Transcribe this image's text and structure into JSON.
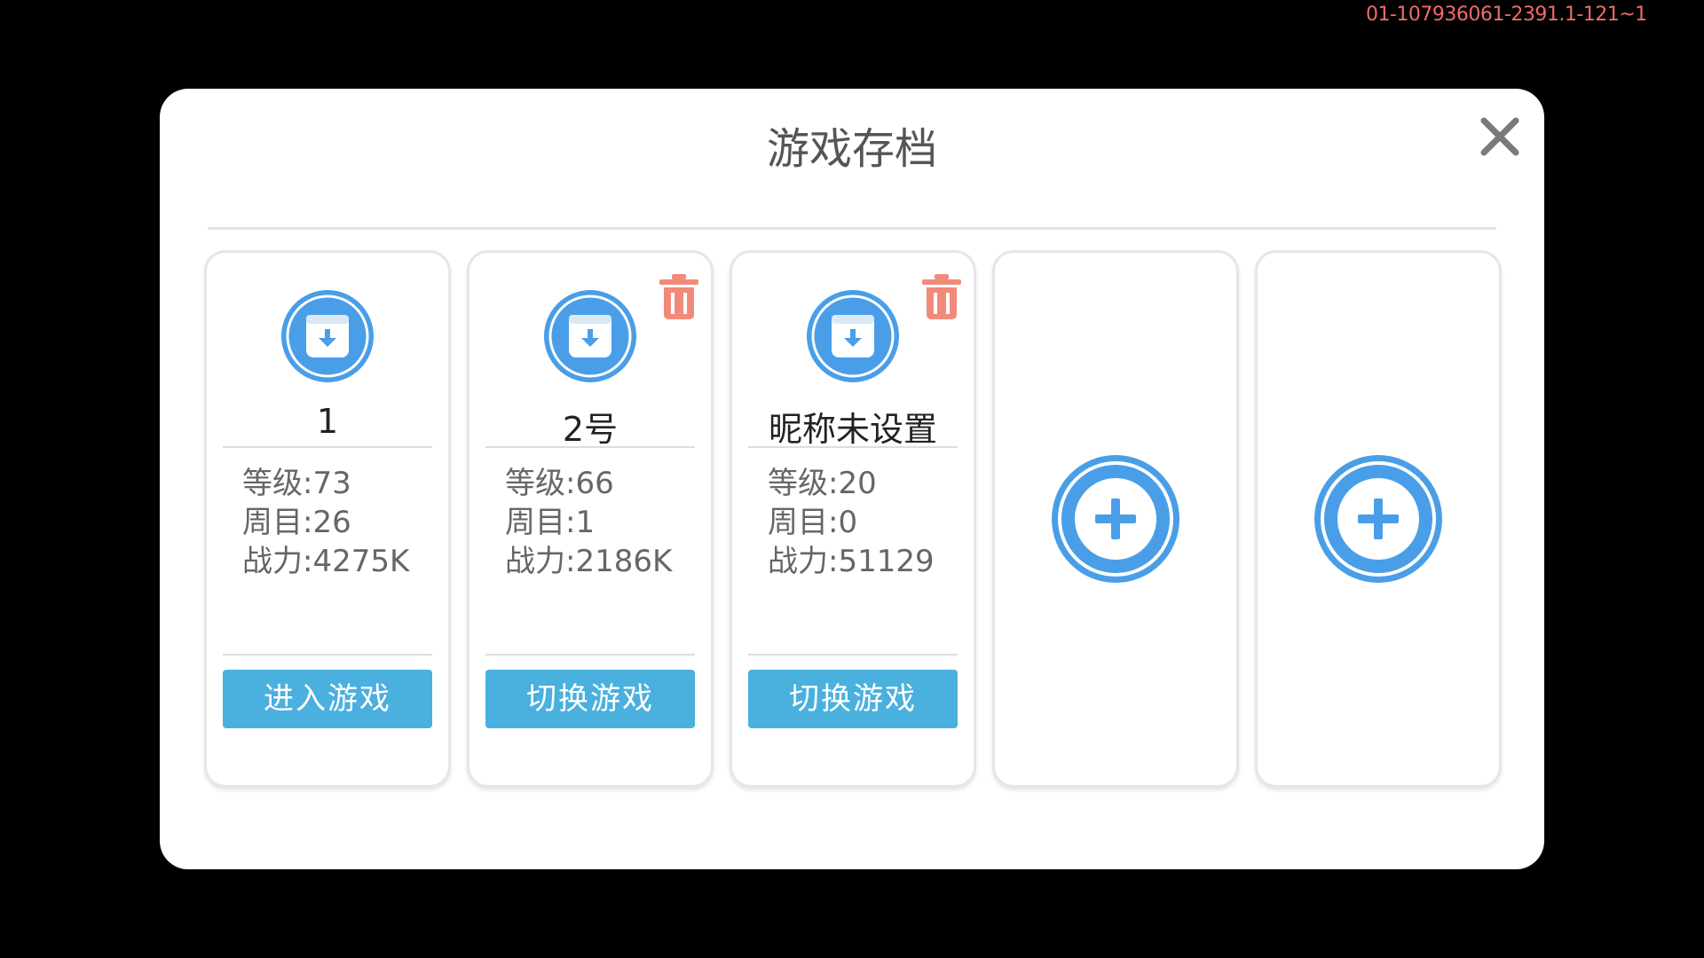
{
  "build_id": "01-107936061-2391.1-121~1",
  "dialog": {
    "title": "游戏存档",
    "close_icon": "close-icon"
  },
  "colors": {
    "accent_blue": "#4a9ee8",
    "button_blue": "#4ab0de",
    "delete_red": "#f28a7a",
    "build_id_red": "#f06a6a"
  },
  "slots": [
    {
      "name": "1",
      "stats": [
        "等级:73",
        "周目:26",
        "战力:4275K"
      ],
      "button_label": "进入游戏",
      "deletable": false,
      "icon": "save-download-icon"
    },
    {
      "name": "2号",
      "stats": [
        "等级:66",
        "周目:1",
        "战力:2186K"
      ],
      "button_label": "切换游戏",
      "deletable": true,
      "icon": "save-download-icon"
    },
    {
      "name": "昵称未设置",
      "stats": [
        "等级:20",
        "周目:0",
        "战力:51129"
      ],
      "button_label": "切换游戏",
      "deletable": true,
      "icon": "save-download-icon"
    },
    {
      "empty": true,
      "icon": "add-icon"
    },
    {
      "empty": true,
      "icon": "add-icon"
    }
  ]
}
